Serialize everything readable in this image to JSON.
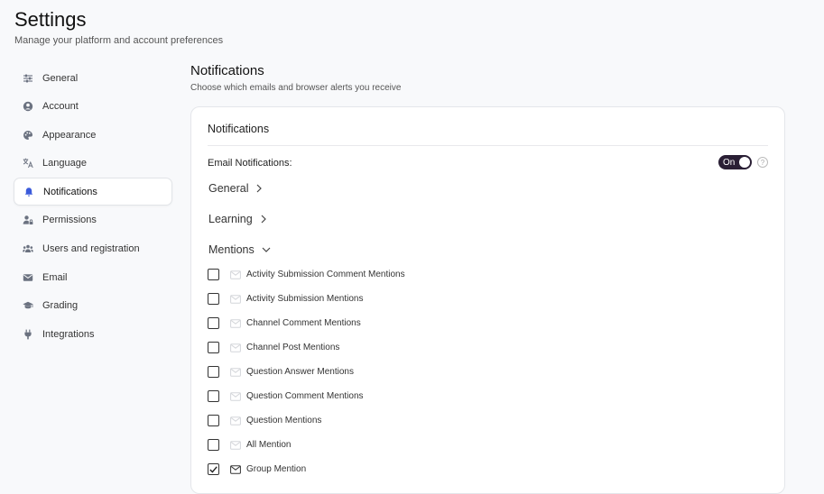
{
  "header": {
    "title": "Settings",
    "subtitle": "Manage your platform and account preferences"
  },
  "sidebar": {
    "items": [
      {
        "label": "General",
        "icon": "sliders-icon"
      },
      {
        "label": "Account",
        "icon": "user-circle-icon"
      },
      {
        "label": "Appearance",
        "icon": "palette-icon"
      },
      {
        "label": "Language",
        "icon": "translate-icon"
      },
      {
        "label": "Notifications",
        "icon": "bell-icon",
        "active": true
      },
      {
        "label": "Permissions",
        "icon": "user-lock-icon"
      },
      {
        "label": "Users and registration",
        "icon": "users-icon"
      },
      {
        "label": "Email",
        "icon": "envelope-icon"
      },
      {
        "label": "Grading",
        "icon": "graduation-cap-icon"
      },
      {
        "label": "Integrations",
        "icon": "plug-icon"
      }
    ]
  },
  "main": {
    "title": "Notifications",
    "subtitle": "Choose which emails and browser alerts you receive",
    "card": {
      "title": "Notifications",
      "email_notifications": {
        "label": "Email Notifications:",
        "toggle_text": "On",
        "enabled": true
      },
      "groups": [
        {
          "label": "General",
          "expanded": false
        },
        {
          "label": "Learning",
          "expanded": false
        },
        {
          "label": "Mentions",
          "expanded": true
        }
      ],
      "mentions": [
        {
          "label": "Activity Submission Comment Mentions",
          "checked": false
        },
        {
          "label": "Activity Submission Mentions",
          "checked": false
        },
        {
          "label": "Channel Comment Mentions",
          "checked": false
        },
        {
          "label": "Channel Post Mentions",
          "checked": false
        },
        {
          "label": "Question Answer Mentions",
          "checked": false
        },
        {
          "label": "Question Comment Mentions",
          "checked": false
        },
        {
          "label": "Question Mentions",
          "checked": false
        },
        {
          "label": "All Mention",
          "checked": false
        },
        {
          "label": "Group Mention",
          "checked": true
        }
      ]
    }
  },
  "colors": {
    "accent": "#2a1f35",
    "background": "#f8f9fb",
    "card": "#ffffff",
    "bell_active": "#3b5bdb"
  }
}
